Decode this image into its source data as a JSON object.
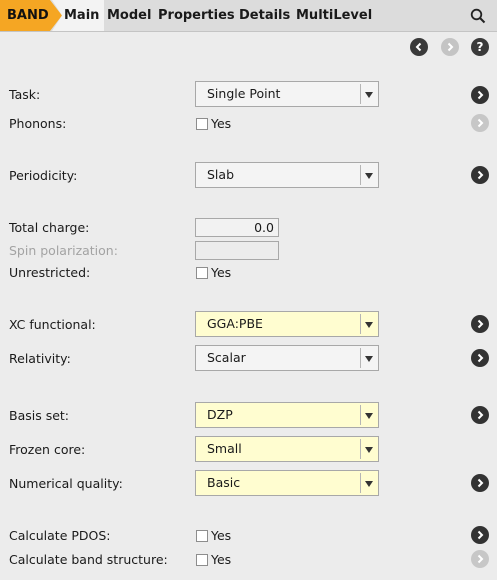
{
  "tabs": {
    "band": "BAND",
    "main": "Main",
    "model": "Model",
    "properties": "Properties",
    "details": "Details",
    "multilevel": "MultiLevel"
  },
  "nav": {
    "help": "?"
  },
  "fields": {
    "task": {
      "label": "Task:",
      "value": "Single Point"
    },
    "phonons": {
      "label": "Phonons:",
      "checkbox": "Yes"
    },
    "periodicity": {
      "label": "Periodicity:",
      "value": "Slab"
    },
    "total_charge": {
      "label": "Total charge:",
      "value": "0.0"
    },
    "spin_polarization": {
      "label": "Spin polarization:",
      "value": ""
    },
    "unrestricted": {
      "label": "Unrestricted:",
      "checkbox": "Yes"
    },
    "xc_functional": {
      "label": "XC functional:",
      "value": "GGA:PBE"
    },
    "relativity": {
      "label": "Relativity:",
      "value": "Scalar"
    },
    "basis_set": {
      "label": "Basis set:",
      "value": "DZP"
    },
    "frozen_core": {
      "label": "Frozen core:",
      "value": "Small"
    },
    "numerical_quality": {
      "label": "Numerical quality:",
      "value": "Basic"
    },
    "calc_pdos": {
      "label": "Calculate PDOS:",
      "checkbox": "Yes"
    },
    "calc_band": {
      "label": "Calculate band structure:",
      "checkbox": "Yes"
    }
  },
  "colors": {
    "band_tab": "#f5a623",
    "highlight_field": "#fffdd0",
    "background": "#ececec"
  }
}
